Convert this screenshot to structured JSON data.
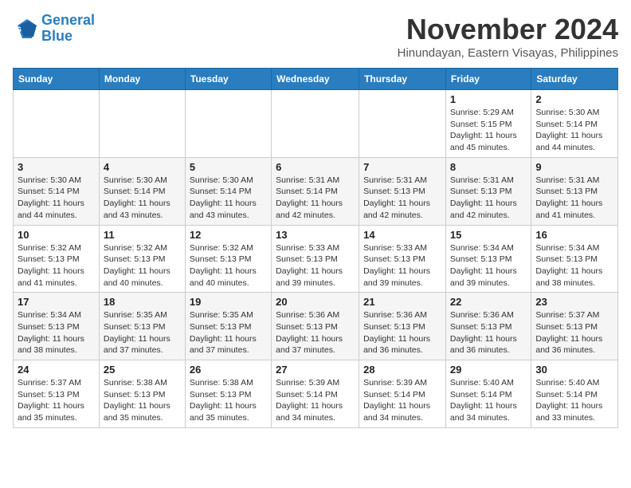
{
  "header": {
    "logo_line1": "General",
    "logo_line2": "Blue",
    "month": "November 2024",
    "location": "Hinundayan, Eastern Visayas, Philippines"
  },
  "weekdays": [
    "Sunday",
    "Monday",
    "Tuesday",
    "Wednesday",
    "Thursday",
    "Friday",
    "Saturday"
  ],
  "weeks": [
    [
      {
        "day": "",
        "info": ""
      },
      {
        "day": "",
        "info": ""
      },
      {
        "day": "",
        "info": ""
      },
      {
        "day": "",
        "info": ""
      },
      {
        "day": "",
        "info": ""
      },
      {
        "day": "1",
        "info": "Sunrise: 5:29 AM\nSunset: 5:15 PM\nDaylight: 11 hours\nand 45 minutes."
      },
      {
        "day": "2",
        "info": "Sunrise: 5:30 AM\nSunset: 5:14 PM\nDaylight: 11 hours\nand 44 minutes."
      }
    ],
    [
      {
        "day": "3",
        "info": "Sunrise: 5:30 AM\nSunset: 5:14 PM\nDaylight: 11 hours\nand 44 minutes."
      },
      {
        "day": "4",
        "info": "Sunrise: 5:30 AM\nSunset: 5:14 PM\nDaylight: 11 hours\nand 43 minutes."
      },
      {
        "day": "5",
        "info": "Sunrise: 5:30 AM\nSunset: 5:14 PM\nDaylight: 11 hours\nand 43 minutes."
      },
      {
        "day": "6",
        "info": "Sunrise: 5:31 AM\nSunset: 5:14 PM\nDaylight: 11 hours\nand 42 minutes."
      },
      {
        "day": "7",
        "info": "Sunrise: 5:31 AM\nSunset: 5:13 PM\nDaylight: 11 hours\nand 42 minutes."
      },
      {
        "day": "8",
        "info": "Sunrise: 5:31 AM\nSunset: 5:13 PM\nDaylight: 11 hours\nand 42 minutes."
      },
      {
        "day": "9",
        "info": "Sunrise: 5:31 AM\nSunset: 5:13 PM\nDaylight: 11 hours\nand 41 minutes."
      }
    ],
    [
      {
        "day": "10",
        "info": "Sunrise: 5:32 AM\nSunset: 5:13 PM\nDaylight: 11 hours\nand 41 minutes."
      },
      {
        "day": "11",
        "info": "Sunrise: 5:32 AM\nSunset: 5:13 PM\nDaylight: 11 hours\nand 40 minutes."
      },
      {
        "day": "12",
        "info": "Sunrise: 5:32 AM\nSunset: 5:13 PM\nDaylight: 11 hours\nand 40 minutes."
      },
      {
        "day": "13",
        "info": "Sunrise: 5:33 AM\nSunset: 5:13 PM\nDaylight: 11 hours\nand 39 minutes."
      },
      {
        "day": "14",
        "info": "Sunrise: 5:33 AM\nSunset: 5:13 PM\nDaylight: 11 hours\nand 39 minutes."
      },
      {
        "day": "15",
        "info": "Sunrise: 5:34 AM\nSunset: 5:13 PM\nDaylight: 11 hours\nand 39 minutes."
      },
      {
        "day": "16",
        "info": "Sunrise: 5:34 AM\nSunset: 5:13 PM\nDaylight: 11 hours\nand 38 minutes."
      }
    ],
    [
      {
        "day": "17",
        "info": "Sunrise: 5:34 AM\nSunset: 5:13 PM\nDaylight: 11 hours\nand 38 minutes."
      },
      {
        "day": "18",
        "info": "Sunrise: 5:35 AM\nSunset: 5:13 PM\nDaylight: 11 hours\nand 37 minutes."
      },
      {
        "day": "19",
        "info": "Sunrise: 5:35 AM\nSunset: 5:13 PM\nDaylight: 11 hours\nand 37 minutes."
      },
      {
        "day": "20",
        "info": "Sunrise: 5:36 AM\nSunset: 5:13 PM\nDaylight: 11 hours\nand 37 minutes."
      },
      {
        "day": "21",
        "info": "Sunrise: 5:36 AM\nSunset: 5:13 PM\nDaylight: 11 hours\nand 36 minutes."
      },
      {
        "day": "22",
        "info": "Sunrise: 5:36 AM\nSunset: 5:13 PM\nDaylight: 11 hours\nand 36 minutes."
      },
      {
        "day": "23",
        "info": "Sunrise: 5:37 AM\nSunset: 5:13 PM\nDaylight: 11 hours\nand 36 minutes."
      }
    ],
    [
      {
        "day": "24",
        "info": "Sunrise: 5:37 AM\nSunset: 5:13 PM\nDaylight: 11 hours\nand 35 minutes."
      },
      {
        "day": "25",
        "info": "Sunrise: 5:38 AM\nSunset: 5:13 PM\nDaylight: 11 hours\nand 35 minutes."
      },
      {
        "day": "26",
        "info": "Sunrise: 5:38 AM\nSunset: 5:13 PM\nDaylight: 11 hours\nand 35 minutes."
      },
      {
        "day": "27",
        "info": "Sunrise: 5:39 AM\nSunset: 5:14 PM\nDaylight: 11 hours\nand 34 minutes."
      },
      {
        "day": "28",
        "info": "Sunrise: 5:39 AM\nSunset: 5:14 PM\nDaylight: 11 hours\nand 34 minutes."
      },
      {
        "day": "29",
        "info": "Sunrise: 5:40 AM\nSunset: 5:14 PM\nDaylight: 11 hours\nand 34 minutes."
      },
      {
        "day": "30",
        "info": "Sunrise: 5:40 AM\nSunset: 5:14 PM\nDaylight: 11 hours\nand 33 minutes."
      }
    ]
  ]
}
